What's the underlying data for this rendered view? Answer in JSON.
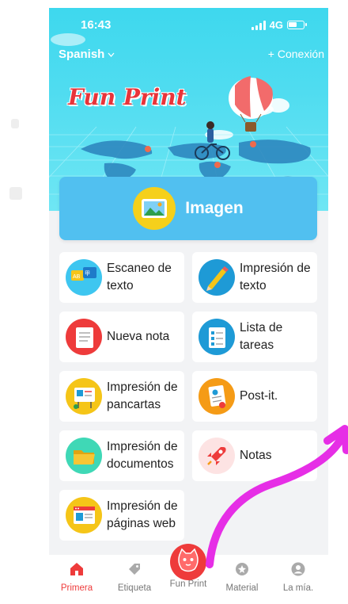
{
  "status": {
    "time": "16:43",
    "network": "4G"
  },
  "header": {
    "language": "Spanish",
    "login": "+ Conexión"
  },
  "brand": {
    "logo_text": "Fun Print"
  },
  "primary_action": {
    "label": "Imagen",
    "icon": "gallery-icon"
  },
  "features": [
    {
      "label_line1": "Escaneo de",
      "label_line2": "texto",
      "icon": "text-scan-icon",
      "color": "#3ec6f0"
    },
    {
      "label_line1": "Impresión de",
      "label_line2": "texto",
      "icon": "pencil-icon",
      "color": "#1e9ad6"
    },
    {
      "label_line1": "Nueva nota",
      "label_line2": "",
      "icon": "note-icon",
      "color": "#ee3b3b"
    },
    {
      "label_line1": "Lista de",
      "label_line2": "tareas",
      "icon": "checklist-icon",
      "color": "#1e9ad6"
    },
    {
      "label_line1": "Impresión de",
      "label_line2": "pancartas",
      "icon": "banner-icon",
      "color": "#f5c518"
    },
    {
      "label_line1": "Post-it.",
      "label_line2": "",
      "icon": "sticky-note-icon",
      "color": "#f59b16"
    },
    {
      "label_line1": "Impresión de",
      "label_line2": "documentos",
      "icon": "folder-icon",
      "color": "#3fd8b6"
    },
    {
      "label_line1": "Notas",
      "label_line2": "",
      "icon": "rocket-icon",
      "color": "#fde3e3"
    },
    {
      "label_line1": "Impresión de",
      "label_line2": "páginas web",
      "icon": "webpage-icon",
      "color": "#f5c518"
    }
  ],
  "tabs": [
    {
      "label": "Primera",
      "icon": "home-icon",
      "active": true
    },
    {
      "label": "Etiqueta",
      "icon": "tag-icon",
      "active": false
    },
    {
      "label": "Fun Print",
      "icon": "cat-icon",
      "active": false
    },
    {
      "label": "Material",
      "icon": "material-icon",
      "active": false
    },
    {
      "label": "La mía.",
      "icon": "profile-icon",
      "active": false
    }
  ],
  "colors": {
    "accent": "#ee3b3b",
    "hero": "#4fdcf0",
    "image_card": "#51c0f0",
    "annotation_arrow": "#e62ee6"
  }
}
